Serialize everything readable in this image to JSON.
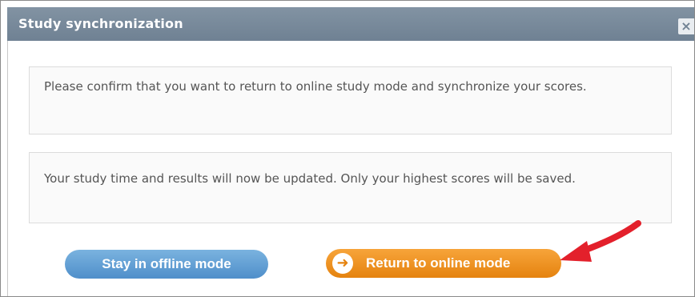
{
  "dialog": {
    "title": "Study synchronization",
    "close_glyph": "×",
    "messages": [
      "Please confirm that you want to return to online study mode and synchronize your scores.",
      "Your study time and results will now be updated. Only your highest scores will be saved."
    ],
    "buttons": {
      "offline_label": "Stay in offline mode",
      "online_label": "Return to online mode",
      "online_icon": "arrow-right-circle-icon"
    }
  },
  "colors": {
    "titlebar": "#6f8193",
    "offline_button": "#5b9ad2",
    "online_button": "#ee9324",
    "annotation_arrow": "#e3202b"
  }
}
